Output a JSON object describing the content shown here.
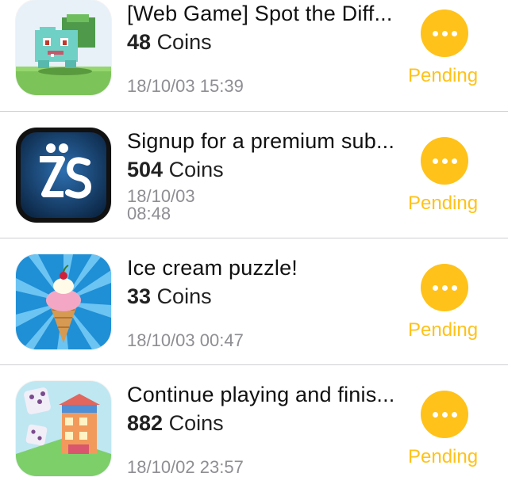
{
  "colors": {
    "accent": "#ffc21a",
    "secondary_text": "#8e8e93",
    "separator": "#cfcfd3"
  },
  "offers": [
    {
      "icon": "pixel-monster-app-icon",
      "title": "[Web Game] Spot the Diff...",
      "coins_amount": "48",
      "coins_unit": "Coins",
      "time": "18/10/03 15:39",
      "status": "Pending",
      "more_icon": "ellipsis-icon"
    },
    {
      "icon": "zs-app-icon",
      "title": "Signup for a premium sub...",
      "coins_amount": "504",
      "coins_unit": "Coins",
      "time_date": "18/10/03",
      "time_clock": "08:48",
      "status": "Pending",
      "more_icon": "ellipsis-icon"
    },
    {
      "icon": "ice-cream-app-icon",
      "title": "Ice cream puzzle!",
      "coins_amount": "33",
      "coins_unit": "Coins",
      "time": "18/10/03 00:47",
      "status": "Pending",
      "more_icon": "ellipsis-icon"
    },
    {
      "icon": "dice-city-app-icon",
      "title": "Continue playing and finis...",
      "coins_amount": "882",
      "coins_unit": "Coins",
      "time": "18/10/02 23:57",
      "status": "Pending",
      "more_icon": "ellipsis-icon"
    }
  ]
}
